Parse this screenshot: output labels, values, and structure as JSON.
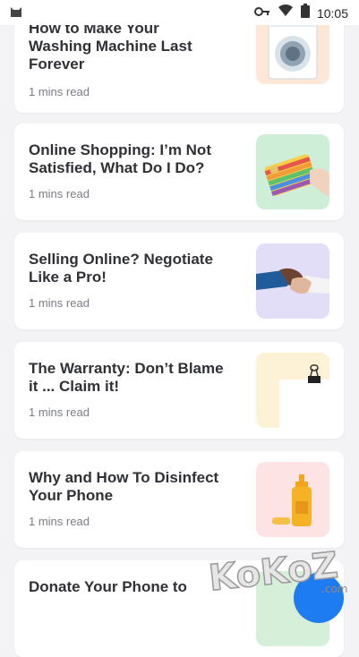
{
  "status_bar": {
    "time": "10:05",
    "icons": [
      "cat-app-icon",
      "key-icon",
      "wifi-icon",
      "battery-icon"
    ]
  },
  "articles": [
    {
      "title": "How to Make Your Washing Machine Last Forever",
      "meta": "1 mins read",
      "image": "washing-machine",
      "bg": "#fde7d6"
    },
    {
      "title": "Online Shopping: I’m Not Satisfied, What Do I Do?",
      "meta": "1 mins read",
      "image": "credit-card",
      "bg": "#cfeed8"
    },
    {
      "title": "Selling Online? Negotiate Like a Pro!",
      "meta": "1 mins read",
      "image": "handshake",
      "bg": "#e3def8"
    },
    {
      "title": "The Warranty: Don’t Blame it ... Claim it!",
      "meta": "1 mins read",
      "image": "binder-clip-paper",
      "bg": "#fdf1d6"
    },
    {
      "title": "Why and How To Disinfect Your Phone",
      "meta": "1 mins read",
      "image": "disinfectant-bottle",
      "bg": "#fde3e3"
    },
    {
      "title": "Donate Your Phone to",
      "meta": "",
      "image": "phone",
      "bg": "#d6efd9"
    }
  ],
  "watermark": {
    "text": "KoKoZ",
    "suffix": ".com"
  }
}
